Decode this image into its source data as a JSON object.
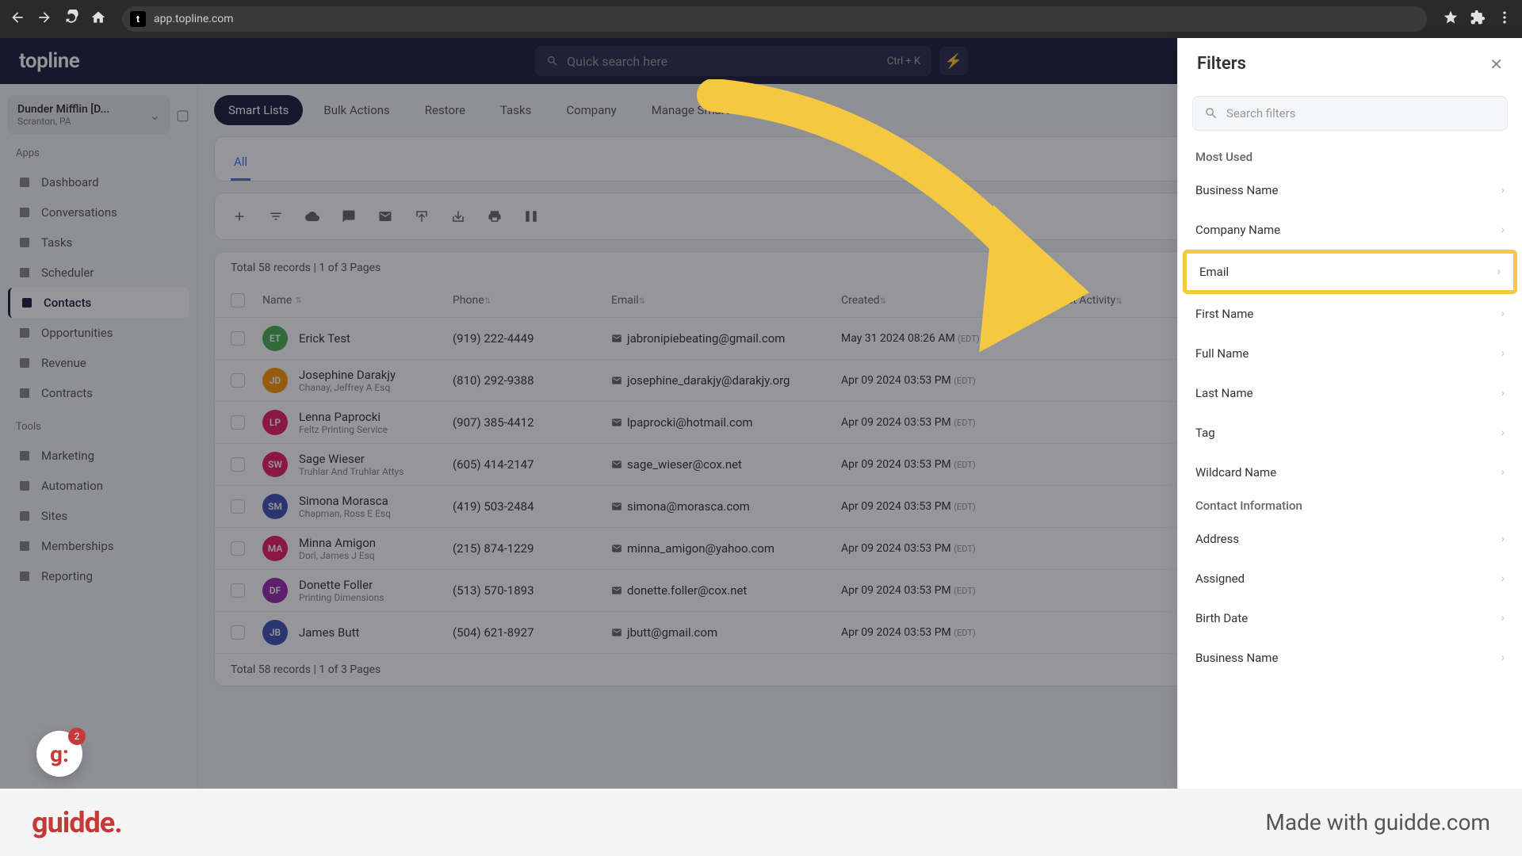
{
  "browser": {
    "url": "app.topline.com",
    "favicon": "t"
  },
  "header": {
    "logo": "topline",
    "search_placeholder": "Quick search here",
    "shortcut": "Ctrl + K"
  },
  "company": {
    "name": "Dunder Mifflin [D...",
    "location": "Scranton, PA"
  },
  "sidebar": {
    "apps_label": "Apps",
    "tools_label": "Tools",
    "apps": [
      {
        "label": "Dashboard"
      },
      {
        "label": "Conversations"
      },
      {
        "label": "Tasks"
      },
      {
        "label": "Scheduler"
      },
      {
        "label": "Contacts",
        "active": true
      },
      {
        "label": "Opportunities"
      },
      {
        "label": "Revenue"
      },
      {
        "label": "Contracts"
      }
    ],
    "tools": [
      {
        "label": "Marketing"
      },
      {
        "label": "Automation"
      },
      {
        "label": "Sites"
      },
      {
        "label": "Memberships"
      },
      {
        "label": "Reporting"
      }
    ]
  },
  "nav_tabs": [
    {
      "label": "Smart Lists",
      "active": true
    },
    {
      "label": "Bulk Actions"
    },
    {
      "label": "Restore"
    },
    {
      "label": "Tasks"
    },
    {
      "label": "Company"
    },
    {
      "label": "Manage Smart Lists"
    }
  ],
  "sub_tab": "All",
  "toolbar_search": "Quick search",
  "records_top": "Total 58 records | 1 of 3 Pages",
  "records_bottom": "Total 58 records | 1 of 3 Pages",
  "columns": {
    "name": "Name",
    "phone": "Phone",
    "email": "Email",
    "created": "Created",
    "activity": "Last Activity"
  },
  "contacts": [
    {
      "initials": "ET",
      "color": "#4caf50",
      "name": "Erick Test",
      "sub": "",
      "phone": "(919) 222-4449",
      "email": "jabronipiebeating@gmail.com",
      "created": "May 31 2024 08:26 AM",
      "tz": "(EDT)"
    },
    {
      "initials": "JD",
      "color": "#ff9800",
      "name": "Josephine Darakjy",
      "sub": "Chanay, Jeffrey A Esq",
      "phone": "(810) 292-9388",
      "email": "josephine_darakjy@darakjy.org",
      "created": "Apr 09 2024 03:53 PM",
      "tz": "(EDT)"
    },
    {
      "initials": "LP",
      "color": "#e91e63",
      "name": "Lenna Paprocki",
      "sub": "Feltz Printing Service",
      "phone": "(907) 385-4412",
      "email": "lpaprocki@hotmail.com",
      "created": "Apr 09 2024 03:53 PM",
      "tz": "(EDT)"
    },
    {
      "initials": "SW",
      "color": "#e91e63",
      "name": "Sage Wieser",
      "sub": "Truhlar And Truhlar Attys",
      "phone": "(605) 414-2147",
      "email": "sage_wieser@cox.net",
      "created": "Apr 09 2024 03:53 PM",
      "tz": "(EDT)"
    },
    {
      "initials": "SM",
      "color": "#3f51b5",
      "name": "Simona Morasca",
      "sub": "Chapman, Ross E Esq",
      "phone": "(419) 503-2484",
      "email": "simona@morasca.com",
      "created": "Apr 09 2024 03:53 PM",
      "tz": "(EDT)"
    },
    {
      "initials": "MA",
      "color": "#e91e63",
      "name": "Minna Amigon",
      "sub": "Dorl, James J Esq",
      "phone": "(215) 874-1229",
      "email": "minna_amigon@yahoo.com",
      "created": "Apr 09 2024 03:53 PM",
      "tz": "(EDT)"
    },
    {
      "initials": "DF",
      "color": "#9c27b0",
      "name": "Donette Foller",
      "sub": "Printing Dimensions",
      "phone": "(513) 570-1893",
      "email": "donette.foller@cox.net",
      "created": "Apr 09 2024 03:53 PM",
      "tz": "(EDT)"
    },
    {
      "initials": "JB",
      "color": "#3f51b5",
      "name": "James Butt",
      "sub": "",
      "phone": "(504) 621-8927",
      "email": "jbutt@gmail.com",
      "created": "Apr 09 2024 03:53 PM",
      "tz": "(EDT)"
    }
  ],
  "filters": {
    "title": "Filters",
    "search_placeholder": "Search filters",
    "most_used_label": "Most Used",
    "contact_info_label": "Contact Information",
    "most_used": [
      {
        "label": "Business Name"
      },
      {
        "label": "Company Name"
      },
      {
        "label": "Email",
        "highlighted": true
      },
      {
        "label": "First Name"
      },
      {
        "label": "Full Name"
      },
      {
        "label": "Last Name"
      },
      {
        "label": "Tag"
      },
      {
        "label": "Wildcard Name"
      }
    ],
    "contact_info": [
      {
        "label": "Address"
      },
      {
        "label": "Assigned"
      },
      {
        "label": "Birth Date"
      },
      {
        "label": "Business Name"
      }
    ]
  },
  "badge_count": "2",
  "footer": {
    "logo": "guidde.",
    "made": "Made with guidde.com"
  }
}
